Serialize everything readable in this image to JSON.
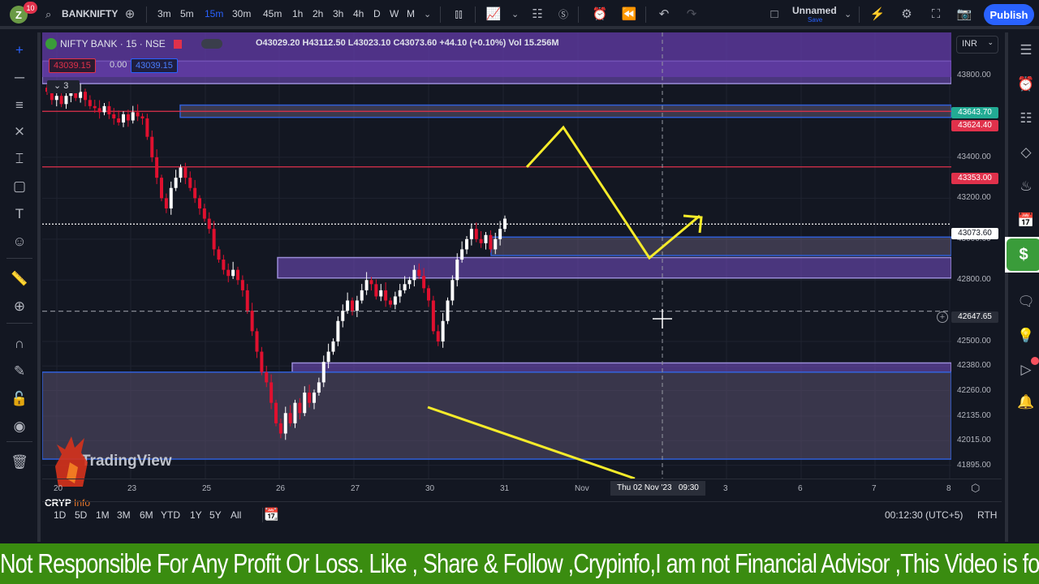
{
  "topbar": {
    "avatar_letter": "Z",
    "notification_count": "10",
    "symbol": "BANKNIFTY",
    "intervals": [
      "3m",
      "5m",
      "15m",
      "30m",
      "45m",
      "1h",
      "2h",
      "3h",
      "4h",
      "D",
      "W",
      "M"
    ],
    "active_interval": "15m",
    "layout_name": "Unnamed",
    "save_label": "Save",
    "publish_label": "Publish"
  },
  "legend": {
    "title": "NIFTY BANK · 15 · NSE",
    "open": "O43029.20",
    "high": "H43112.50",
    "low": "L43023.10",
    "close": "C43073.60",
    "change": "+44.10 (+0.10%)",
    "volume": "Vol 15.256M",
    "sell_price": "43039.15",
    "spread": "0.00",
    "buy_price": "43039.15",
    "collapse_count": "3"
  },
  "currency": "INR",
  "price_tags": {
    "green": "43643.70",
    "red1": "43624.40",
    "red2": "43353.00",
    "last": "43073.60",
    "crosshair": "42647.65"
  },
  "crosshair_date": "Thu 02 Nov '23   09:30",
  "bottom": {
    "ranges": [
      "1D",
      "5D",
      "1M",
      "3M",
      "6M",
      "YTD",
      "1Y",
      "5Y",
      "All"
    ],
    "clock": "00:12:30 (UTC+5)",
    "session": "RTH"
  },
  "watermark": "TradingView",
  "logo_text": "CRYP",
  "logo_text2": "Info",
  "ticker_text": "Not Responsible For Any Profit Or Loss. Like , Share & Follow ,Crypinfo,I am not Financial Advisor ,This Video is for E",
  "colors": {
    "up": "#ffffff",
    "down": "#e0102f",
    "accent": "#2962ff",
    "drawing": "#f5eb2a",
    "ticker_bg": "#3a8c10"
  },
  "chart_data": {
    "type": "candlestick",
    "title": "NIFTY BANK · 15 · NSE",
    "ylim": [
      41830,
      44010
    ],
    "y_ticks": [
      43800,
      43400,
      43200,
      43000,
      42800,
      42500,
      42380,
      42260,
      42135,
      42015,
      41895
    ],
    "x_ticks": [
      "20",
      "23",
      "25",
      "26",
      "27",
      "30",
      "31",
      "Nov",
      "3",
      "6",
      "7",
      "8"
    ],
    "hlines": [
      {
        "price": 43624.4,
        "color": "#e0314b",
        "label": "43624.40"
      },
      {
        "price": 43353.0,
        "color": "#e0314b",
        "label": "43353.00"
      },
      {
        "price": 43073.6,
        "color": "#ffffff",
        "style": "dotted",
        "label": "43073.60"
      },
      {
        "price": 42647.65,
        "color": "#9598a1",
        "style": "dashed",
        "label": "42647.65"
      }
    ],
    "zones": [
      {
        "top": 43870,
        "bottom": 43760,
        "color": "purple"
      },
      {
        "top": 43655,
        "bottom": 43595,
        "color": "grey-blue"
      },
      {
        "top": 43010,
        "bottom": 42920,
        "color": "grey-blue"
      },
      {
        "top": 42910,
        "bottom": 42810,
        "color": "purple"
      },
      {
        "top": 42395,
        "bottom": 42350,
        "color": "purple"
      },
      {
        "top": 42350,
        "bottom": 41925,
        "color": "grey"
      }
    ],
    "candles_close_path": [
      43720,
      43680,
      43700,
      43660,
      43700,
      43740,
      43690,
      43720,
      43680,
      43650,
      43640,
      43620,
      43650,
      43610,
      43590,
      43570,
      43610,
      43580,
      43620,
      43600,
      43590,
      43500,
      43400,
      43300,
      43200,
      43150,
      43250,
      43300,
      43350,
      43300,
      43250,
      43200,
      43150,
      43100,
      43050,
      42950,
      42900,
      42850,
      42820,
      42850,
      42800,
      42750,
      42650,
      42550,
      42450,
      42350,
      42300,
      42200,
      42100,
      42050,
      42150,
      42100,
      42200,
      42150,
      42250,
      42200,
      42250,
      42300,
      42400,
      42450,
      42500,
      42600,
      42650,
      42700,
      42650,
      42700,
      42750,
      42800,
      42780,
      42720,
      42750,
      42700,
      42680,
      42720,
      42750,
      42780,
      42800,
      42850,
      42820,
      42760,
      42700,
      42550,
      42500,
      42600,
      42700,
      42800,
      42900,
      42950,
      43000,
      43050,
      43000,
      42980,
      43020,
      42950,
      43000,
      43050,
      43100
    ],
    "drawings": [
      {
        "type": "polyline",
        "color": "#f5eb2a",
        "desc": "zigzag projection up-down-up with arrow"
      },
      {
        "type": "line",
        "color": "#f5eb2a",
        "desc": "descending trendline lower"
      }
    ]
  }
}
